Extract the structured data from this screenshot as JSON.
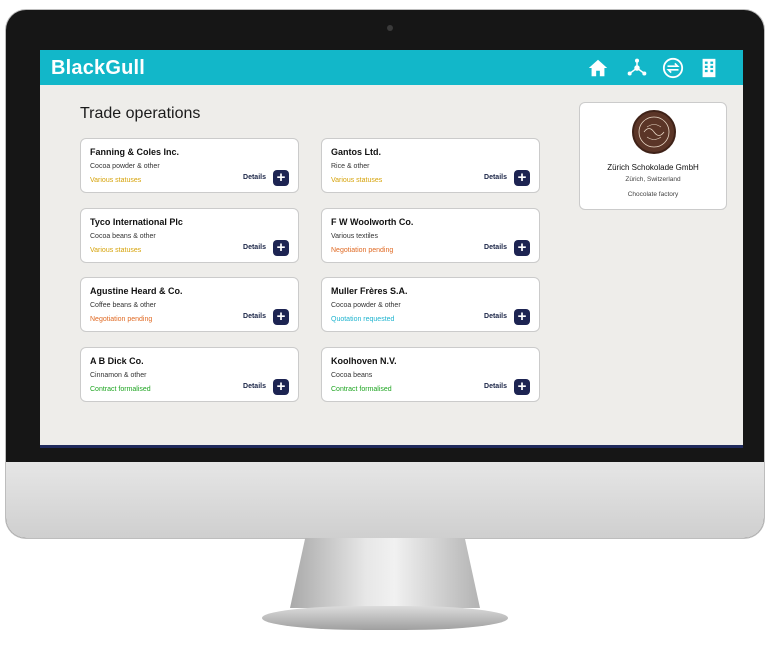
{
  "app": {
    "name": "BlackGull"
  },
  "nav": {
    "icons": [
      "home-icon",
      "network-icon",
      "exchange-icon",
      "building-icon"
    ]
  },
  "page": {
    "title": "Trade operations"
  },
  "cards": [
    {
      "company": "Fanning & Coles Inc.",
      "goods": "Cocoa powder & other",
      "status": "Various statuses",
      "status_color": "#d6a30a",
      "details_label": "Details"
    },
    {
      "company": "Gantos Ltd.",
      "goods": "Rice & other",
      "status": "Various statuses",
      "status_color": "#d6a30a",
      "details_label": "Details"
    },
    {
      "company": "Tyco International Plc",
      "goods": "Cocoa beans & other",
      "status": "Various statuses",
      "status_color": "#d6a30a",
      "details_label": "Details"
    },
    {
      "company": "F W Woolworth Co.",
      "goods": "Various textiles",
      "status": "Negotiation pending",
      "status_color": "#e06a24",
      "details_label": "Details"
    },
    {
      "company": "Agustine Heard & Co.",
      "goods": "Coffee beans & other",
      "status": "Negotiation pending",
      "status_color": "#e06a24",
      "details_label": "Details"
    },
    {
      "company": "Muller Frères S.A.",
      "goods": "Cocoa powder & other",
      "status": "Quotation requested",
      "status_color": "#1fb4cf",
      "details_label": "Details"
    },
    {
      "company": "A B Dick Co.",
      "goods": "Cinnamon & other",
      "status": "Contract formalised",
      "status_color": "#1ea521",
      "details_label": "Details"
    },
    {
      "company": "Koolhoven N.V.",
      "goods": "Cocoa beans",
      "status": "Contract formalised",
      "status_color": "#1ea521",
      "details_label": "Details"
    }
  ],
  "profile": {
    "name": "Zürich Schokolade GmbH",
    "location": "Zürich, Switzerland",
    "type": "Chocolate factory",
    "logo_icon": "chocolate-brand-logo-icon"
  },
  "colors": {
    "topbar": "#12b7c9",
    "button": "#1d2452",
    "background": "#eeedea"
  }
}
